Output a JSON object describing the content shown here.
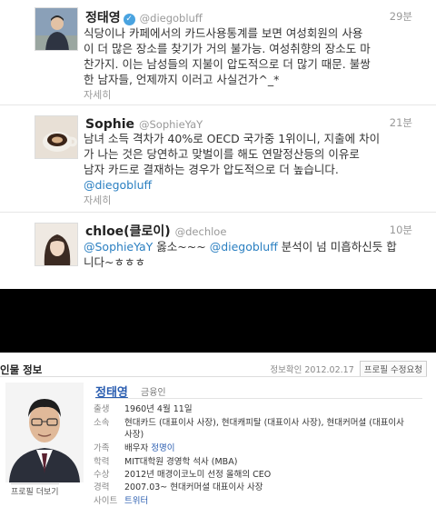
{
  "tweets": [
    {
      "name": "정태영",
      "handle": "@diegobluff",
      "time": "29분",
      "verified": true,
      "lines": [
        "식당이나 카페에서의 카드사용통계를 보면 여성회원의 사용",
        "이 더 많은 장소를 찾기가 거의 불가능. 여성취향의 장소도 마",
        "찬가지. 이는 남성들의 지불이 압도적으로 더 많기 때문. 불쌍",
        "한 남자들, 언제까지 이러고 사실건가^_*"
      ],
      "detail": "자세히"
    },
    {
      "name": "Sophie",
      "handle": "@SophieYaY",
      "time": "21분",
      "lines": [
        "남녀 소득 격차가 40%로 OECD 국가중 1위이니, 지출에 차이",
        "가 나는 것은 당연하고 맞벌이를 해도 연말정산등의 이유로",
        "남자 카드로 결재하는 경우가 압도적으로 더 높습니다."
      ],
      "mention": "@diegobluff",
      "detail": "자세히"
    },
    {
      "name": "chloe(클로이)",
      "handle": "@dechloe",
      "time": "10분",
      "line1_mention_a": "@SophieYaY",
      "line1_text_a": " 옳소~~~ ",
      "line1_mention_b": "@diegobluff",
      "line1_text_b": " 분석이 넘 미흡하신듯 합",
      "line2": "니다~ㅎㅎㅎ"
    }
  ],
  "profile": {
    "section_title": "인물 정보",
    "meta_label": "정보확인",
    "meta_date": "2012.02.17",
    "edit_button": "프로필 수정요청",
    "name": "정태영",
    "job": "금융인",
    "photo_more": "프로필 더보기",
    "rows": [
      {
        "label": "출생",
        "lines": [
          "1960년 4월 11일"
        ]
      },
      {
        "label": "소속",
        "lines": [
          "현대카드 (대표이사 사장), 현대캐피탈 (대표이사 사장), 현대커머셜 (대표이사",
          "사장)"
        ]
      },
      {
        "label": "가족",
        "prefix": "배우자 ",
        "link": "정명이"
      },
      {
        "label": "학력",
        "lines": [
          "MIT대학원 경영학 석사 (MBA)"
        ]
      },
      {
        "label": "수상",
        "lines": [
          "2012년 매경이코노미 선정 올해의 CEO"
        ]
      },
      {
        "label": "경력",
        "lines": [
          "2007.03~ 현대커머셜 대표이사 사장"
        ]
      },
      {
        "label": "사이트",
        "link": "트위터"
      }
    ]
  },
  "colors": {
    "mention": "#2a7fc1",
    "link": "#2a5db0",
    "verified_badge": "#49a3e0",
    "band": "#000000"
  }
}
